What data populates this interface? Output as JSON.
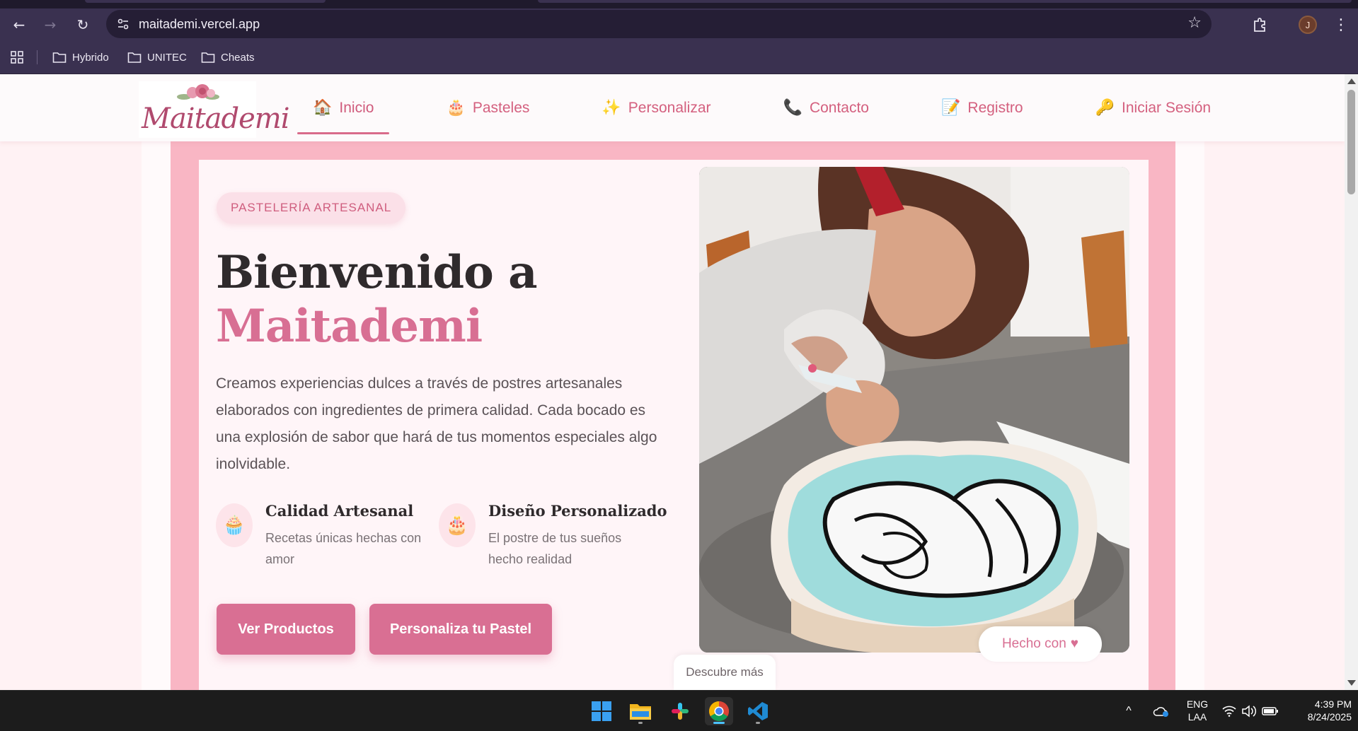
{
  "browser": {
    "url": "maitademi.vercel.app",
    "avatar_letter": "J",
    "bookmarks": [
      "Hybrido",
      "UNITEC",
      "Cheats"
    ]
  },
  "site": {
    "logo_text": "Maitademi",
    "nav": [
      {
        "icon": "house-icon",
        "glyph": "🏠",
        "label": "Inicio"
      },
      {
        "icon": "cake-icon",
        "glyph": "🎂",
        "label": "Pasteles"
      },
      {
        "icon": "sparkles-icon",
        "glyph": "✨",
        "label": "Personalizar"
      },
      {
        "icon": "phone-icon",
        "glyph": "📞",
        "label": "Contacto"
      },
      {
        "icon": "memo-icon",
        "glyph": "📝",
        "label": "Registro"
      },
      {
        "icon": "key-icon",
        "glyph": "🔑",
        "label": "Iniciar Sesión"
      }
    ]
  },
  "hero": {
    "badge": "PASTELERÍA ARTESANAL",
    "title_line1": "Bienvenido a",
    "title_brand": "Maitademi",
    "description": "Creamos experiencias dulces a través de postres artesanales elaborados con ingredientes de primera calidad. Cada bocado es una explosión de sabor que hará de tus momentos especiales algo inolvidable.",
    "features": [
      {
        "icon": "cupcake-icon",
        "glyph": "🧁",
        "title": "Calidad Artesanal",
        "desc": "Recetas únicas hechas con amor"
      },
      {
        "icon": "birthday-cake-icon",
        "glyph": "🎂",
        "title": "Diseño Personalizado",
        "desc": "El postre de tus sueños hecho realidad"
      }
    ],
    "buttons": {
      "primary": "Ver Productos",
      "secondary": "Personaliza tu Pastel"
    },
    "made_with": "Hecho con",
    "heart": "♥",
    "discover": "Descubre más"
  },
  "taskbar": {
    "lang_top": "ENG",
    "lang_bottom": "LAA",
    "time": "4:39 PM",
    "date": "8/24/2025"
  },
  "colors": {
    "accent": "#d96f93",
    "hero_border": "#f9b6c4",
    "chrome": "#3a3150"
  }
}
